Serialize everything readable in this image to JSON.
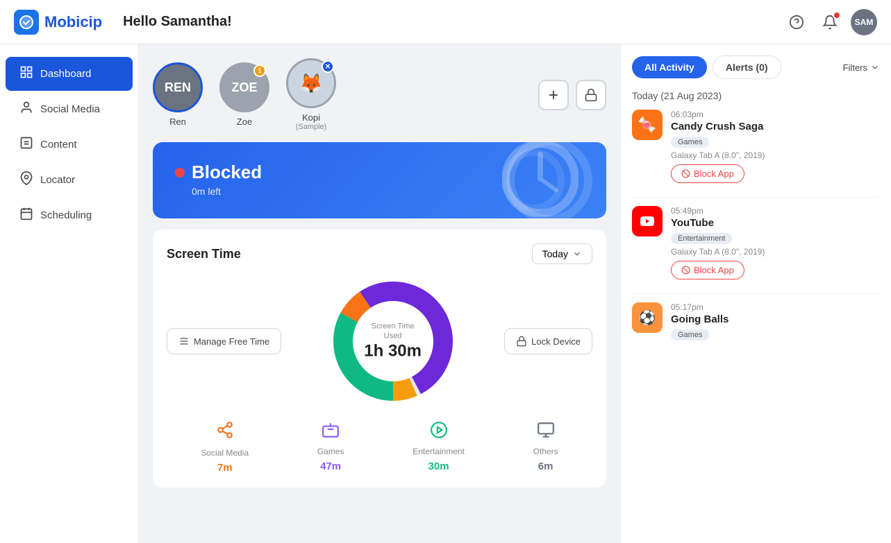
{
  "app": {
    "name": "Mobicip"
  },
  "topbar": {
    "greeting": "Hello Samantha!",
    "help_icon": "?",
    "notif_count": "1",
    "avatar_label": "SAM"
  },
  "sidebar": {
    "items": [
      {
        "id": "dashboard",
        "label": "Dashboard",
        "icon": "⊞",
        "active": true
      },
      {
        "id": "social-media",
        "label": "Social Media",
        "icon": "👤",
        "active": false
      },
      {
        "id": "content",
        "label": "Content",
        "icon": "📋",
        "active": false
      },
      {
        "id": "locator",
        "label": "Locator",
        "icon": "📍",
        "active": false
      },
      {
        "id": "scheduling",
        "label": "Scheduling",
        "icon": "📅",
        "active": false
      }
    ]
  },
  "profiles": [
    {
      "id": "ren",
      "initials": "REN",
      "name": "Ren",
      "color": "#6b7280",
      "border_color": "#1a56db",
      "has_x": false,
      "notif": null
    },
    {
      "id": "zoe",
      "initials": "ZOE",
      "name": "Zoe",
      "color": "#9ca3af",
      "border_color": "#9ca3af",
      "has_x": false,
      "notif": "1"
    },
    {
      "id": "kopi",
      "initials": "",
      "name": "Kopi",
      "sub": "(Sample)",
      "color": "#e5e7eb",
      "border_color": "#9ca3af",
      "has_x": true,
      "notif": null
    }
  ],
  "blocked_banner": {
    "status": "Blocked",
    "time_left": "0m left"
  },
  "screen_time": {
    "title": "Screen Time",
    "filter": "Today",
    "center_label": "Screen Time\nUsed",
    "center_time": "1h 30m",
    "manage_btn": "Manage Free Time",
    "lock_btn": "Lock Device",
    "donut_segments": [
      {
        "label": "Social Media",
        "color": "#f97316",
        "pct": 7.7
      },
      {
        "label": "Games",
        "color": "#6d28d9",
        "pct": 51.7
      },
      {
        "label": "Entertainment",
        "color": "#10b981",
        "pct": 32.9
      },
      {
        "label": "Others",
        "color": "#f59e0b",
        "pct": 6.6
      }
    ],
    "categories": [
      {
        "id": "social-media",
        "icon_color": "#f97316",
        "name": "Social Media",
        "time": "7m"
      },
      {
        "id": "games",
        "icon_color": "#8b5cf6",
        "name": "Games",
        "time": "47m"
      },
      {
        "id": "entertainment",
        "icon_color": "#10b981",
        "name": "Entertainment",
        "time": "30m"
      },
      {
        "id": "others",
        "icon_color": "#6b7280",
        "name": "Others",
        "time": "6m"
      }
    ]
  },
  "right_panel": {
    "tabs": [
      {
        "id": "all-activity",
        "label": "All Activity",
        "active": true
      },
      {
        "id": "alerts",
        "label": "Alerts (0)",
        "active": false
      }
    ],
    "filters_label": "Filters",
    "date_label": "Today (21 Aug 2023)",
    "activities": [
      {
        "time": "06:03pm",
        "app_name": "Candy Crush Saga",
        "tag": "Games",
        "device": "Galaxy Tab A (8.0\", 2019)",
        "block_btn": "Block App",
        "icon_type": "candy"
      },
      {
        "time": "05:49pm",
        "app_name": "YouTube",
        "tag": "Entertainment",
        "device": "Galaxy Tab A (8.0\", 2019)",
        "block_btn": "Block App",
        "icon_type": "youtube"
      },
      {
        "time": "05:17pm",
        "app_name": "Going Balls",
        "tag": "Games",
        "device": "",
        "block_btn": "",
        "icon_type": "balls"
      }
    ]
  }
}
